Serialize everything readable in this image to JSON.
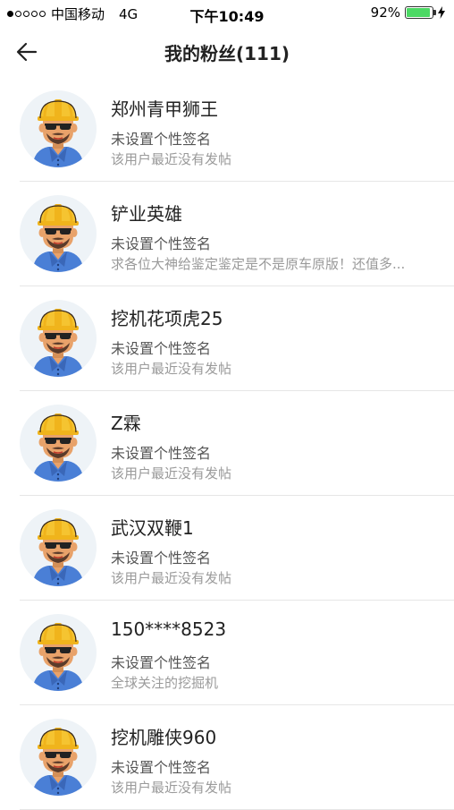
{
  "status_bar": {
    "carrier": "中国移动",
    "network": "4G",
    "time": "下午10:49",
    "battery": "92%",
    "battery_level": 0.92
  },
  "nav": {
    "back_icon": "arrow-left-icon",
    "title": "我的粉丝(111)"
  },
  "followers": [
    {
      "name": "郑州青甲狮王",
      "signature": "未设置个性签名",
      "latest_post": "该用户最近没有发帖"
    },
    {
      "name": "铲业英雄",
      "signature": "未设置个性签名",
      "latest_post": "求各位大神给鉴定鉴定是不是原车原版！还值多..."
    },
    {
      "name": "挖机花项虎25",
      "signature": "未设置个性签名",
      "latest_post": "该用户最近没有发帖"
    },
    {
      "name": "Z霖",
      "signature": "未设置个性签名",
      "latest_post": "该用户最近没有发帖"
    },
    {
      "name": "武汉双鞭1",
      "signature": "未设置个性签名",
      "latest_post": "该用户最近没有发帖"
    },
    {
      "name": "150****8523",
      "signature": "未设置个性签名",
      "latest_post": "全球关注的挖掘机"
    },
    {
      "name": "挖机雕侠960",
      "signature": "未设置个性签名",
      "latest_post": "该用户最近没有发帖"
    }
  ],
  "colors": {
    "helmet": "#f5c431",
    "shirt": "#4a7fd6",
    "skin": "#e8a26a",
    "avatar_bg": "#eef3f7",
    "battery_fill": "#4cd964"
  }
}
